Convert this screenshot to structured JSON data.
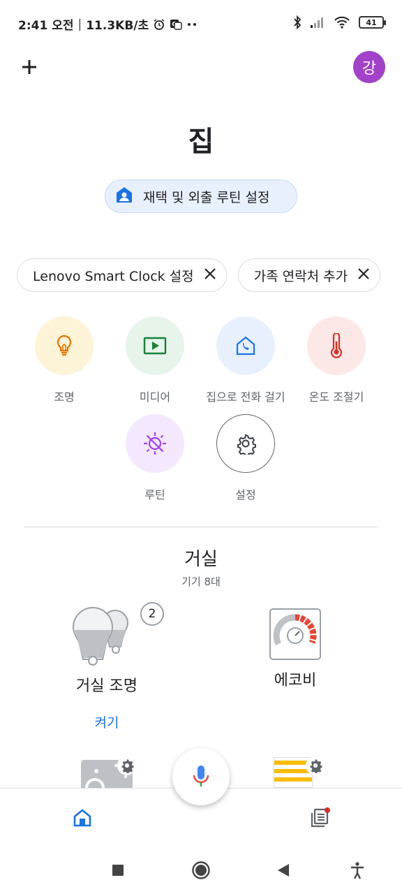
{
  "status_bar": {
    "time": "2:41 오전",
    "speed": "11.3KB/초",
    "battery": "41"
  },
  "header": {
    "avatar_initial": "강",
    "title": "집"
  },
  "routine_chip": {
    "label": "재택 및 외출 루틴 설정"
  },
  "suggestions": [
    {
      "label": "Lenovo Smart Clock 설정"
    },
    {
      "label": "가족 연락처 추가"
    }
  ],
  "shortcuts": [
    {
      "label": "조명",
      "icon": "lightbulb-icon",
      "bg": "#fdf3d7",
      "color": "#e37400"
    },
    {
      "label": "미디어",
      "icon": "media-play-icon",
      "bg": "#e6f4ea",
      "color": "#188038"
    },
    {
      "label": "집으로 전화 걸기",
      "icon": "call-home-icon",
      "bg": "#e8f0fe",
      "color": "#1a73e8"
    },
    {
      "label": "온도 조절기",
      "icon": "thermometer-icon",
      "bg": "#fce8e6",
      "color": "#d93025"
    },
    {
      "label": "루틴",
      "icon": "routine-icon",
      "bg": "#f3e8fd",
      "color": "#a142f4"
    },
    {
      "label": "설정",
      "icon": "gear-icon",
      "bg": "#ffffff",
      "color": "#5f6368"
    }
  ],
  "room": {
    "name": "거실",
    "device_count": "기기 8대"
  },
  "devices": [
    {
      "name": "거실 조명",
      "action": "켜기",
      "badge": "2"
    },
    {
      "name": "에코비"
    }
  ],
  "colors": {
    "accent": "#1a73e8",
    "avatar": "#a142c9"
  }
}
